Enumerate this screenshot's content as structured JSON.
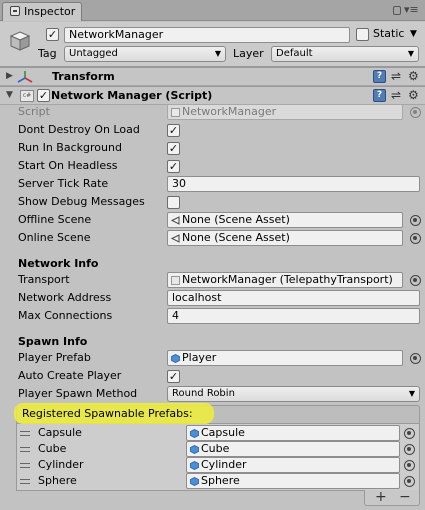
{
  "window": {
    "tab_label": "Inspector"
  },
  "header": {
    "object_name": "NetworkManager",
    "active": true,
    "static_label": "Static",
    "static_checked": false,
    "tag_label": "Tag",
    "tag_value": "Untagged",
    "layer_label": "Layer",
    "layer_value": "Default"
  },
  "components": {
    "transform": {
      "title": "Transform"
    },
    "network_manager": {
      "title": "Network Manager (Script)"
    }
  },
  "fields": {
    "script": {
      "label": "Script",
      "value": "NetworkManager"
    },
    "dont_destroy": {
      "label": "Dont Destroy On Load",
      "checked": true
    },
    "run_in_background": {
      "label": "Run In Background",
      "checked": true
    },
    "start_on_headless": {
      "label": "Start On Headless",
      "checked": true
    },
    "server_tick_rate": {
      "label": "Server Tick Rate",
      "value": "30"
    },
    "show_debug": {
      "label": "Show Debug Messages",
      "checked": false
    },
    "offline_scene": {
      "label": "Offline Scene",
      "value": "None (Scene Asset)"
    },
    "online_scene": {
      "label": "Online Scene",
      "value": "None (Scene Asset)"
    }
  },
  "network_info": {
    "header": "Network Info",
    "transport": {
      "label": "Transport",
      "value": "NetworkManager (TelepathyTransport)"
    },
    "address": {
      "label": "Network Address",
      "value": "localhost"
    },
    "max_connections": {
      "label": "Max Connections",
      "value": "4"
    }
  },
  "spawn_info": {
    "header": "Spawn Info",
    "player_prefab": {
      "label": "Player Prefab",
      "value": "Player"
    },
    "auto_create": {
      "label": "Auto Create Player",
      "checked": true
    },
    "spawn_method": {
      "label": "Player Spawn Method",
      "value": "Round Robin"
    }
  },
  "spawnable": {
    "header": "Registered Spawnable Prefabs:",
    "highlight_color": "#f0f03a",
    "items": [
      {
        "label": "Capsule",
        "value": "Capsule"
      },
      {
        "label": "Cube",
        "value": "Cube"
      },
      {
        "label": "Cylinder",
        "value": "Cylinder"
      },
      {
        "label": "Sphere",
        "value": "Sphere"
      }
    ],
    "add_label": "+",
    "remove_label": "−"
  }
}
